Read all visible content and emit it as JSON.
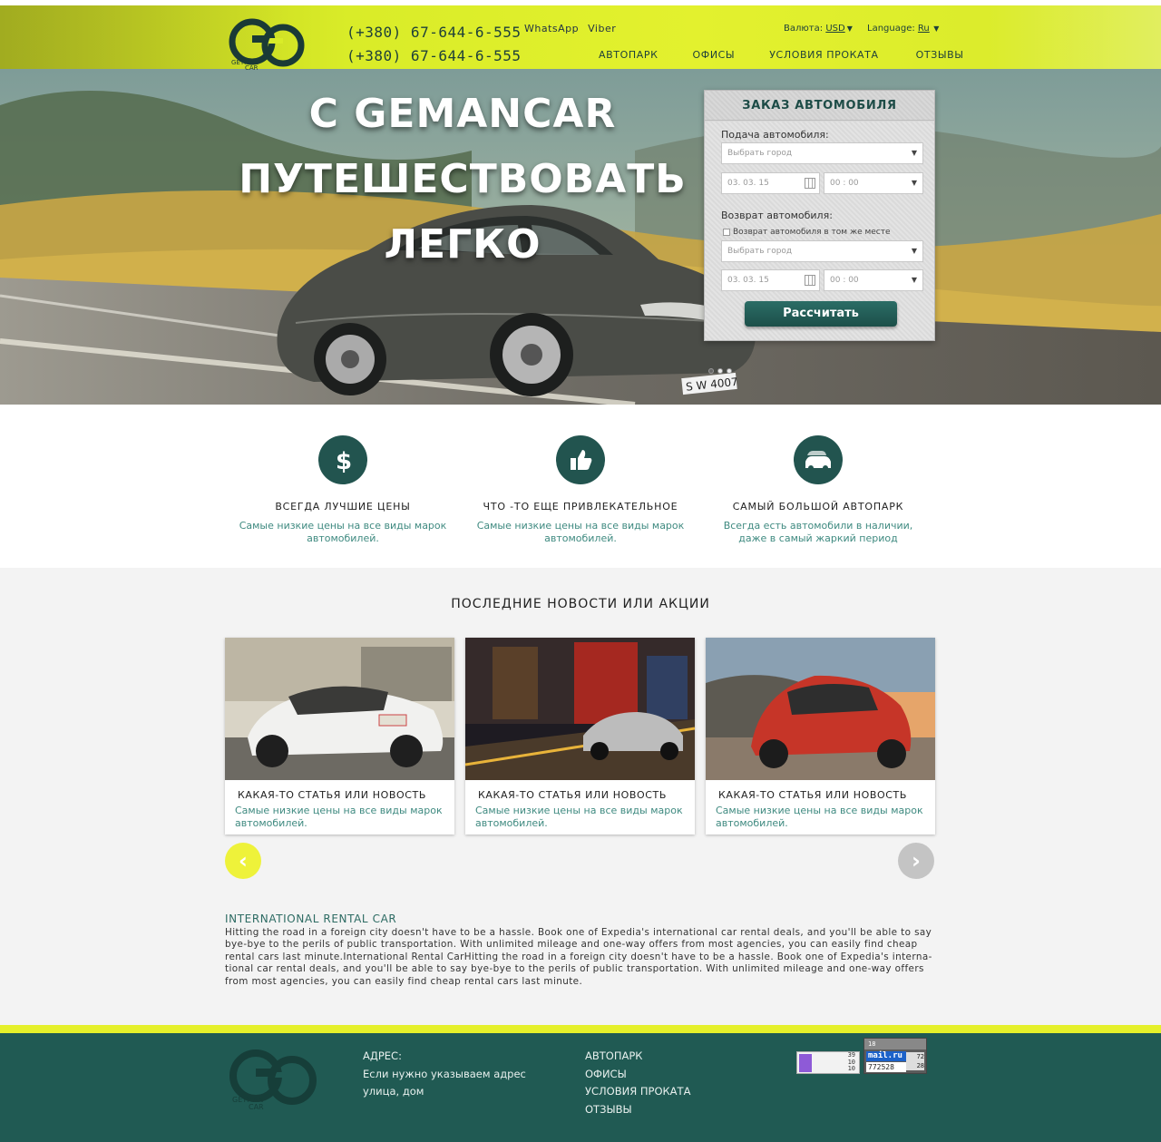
{
  "header": {
    "phones": [
      "(+380) 67-644-6-555",
      "(+380) 67-644-6-555"
    ],
    "messengers": [
      "WhatsApp",
      "Viber"
    ],
    "currency_label": "Валюта:",
    "currency_value": "USD",
    "language_label": "Language:",
    "language_value": "Ru",
    "nav": [
      "АВТОПАРК",
      "ОФИСЫ",
      "УСЛОВИЯ ПРОКАТА",
      "ОТЗЫВЫ"
    ]
  },
  "hero": {
    "title_lines": [
      "С GEMANCAR",
      "ПУТЕШЕСТВОВАТЬ",
      "ЛЕГКО"
    ],
    "license_plate": "S W 4007"
  },
  "order_form": {
    "title": "ЗАКАЗ АВТОМОБИЛЯ",
    "pickup_label": "Подача автомобиля:",
    "pickup_city_placeholder": "Выбрать город",
    "pickup_date": "03. 03. 15",
    "pickup_time": "00 : 00",
    "return_label": "Возврат автомобиля:",
    "same_place_label": "Возврат автомобиля в том же месте",
    "return_city_placeholder": "Выбрать город",
    "return_date": "03. 03. 15",
    "return_time": "00 : 00",
    "submit_label": "Рассчитать"
  },
  "features": [
    {
      "icon": "dollar-icon",
      "title": "ВСЕГДА ЛУЧШИЕ ЦЕНЫ",
      "text": "Самые низкие цены на все виды  марок автомобилей."
    },
    {
      "icon": "thumbs-up-icon",
      "title": "ЧТО -ТО ЕЩЕ ПРИВЛЕКАТЕЛЬНОЕ",
      "text": "Самые низкие цены на все виды  марок автомобилей."
    },
    {
      "icon": "cars-icon",
      "title": "САМЫЙ БОЛЬШОЙ АВТОПАРК",
      "text": "Всегда есть автомобили в наличии, даже в самый жаркий период"
    }
  ],
  "news": {
    "title": "ПОСЛЕДНИЕ НОВОСТИ ИЛИ АКЦИИ",
    "items": [
      {
        "title": "КАКАЯ-ТО СТАТЬЯ ИЛИ НОВОСТЬ",
        "text": "Самые низкие цены на все виды  марок автомобилей.",
        "image": "white-sports-car-photo"
      },
      {
        "title": "КАКАЯ-ТО СТАТЬЯ ИЛИ НОВОСТЬ",
        "text": "Самые низкие цены на все виды  марок автомобилей.",
        "image": "city-night-car-photo"
      },
      {
        "title": "КАКАЯ-ТО СТАТЬЯ ИЛИ НОВОСТЬ",
        "text": "Самые низкие цены на все виды  марок автомобилей.",
        "image": "red-hatchback-photo"
      }
    ]
  },
  "seo": {
    "title": "INTERNATIONAL RENTAL CAR",
    "text": "Hitting the road in a foreign city doesn't have to be a hassle. Book one of Expedia's international car rental deals, and you'll be able to say bye-bye to the perils of public transportation. With unlimited mileage and one-way offers from most agencies, you can easily find cheap rental cars last minute.International Rental CarHitting the road in a foreign city doesn't have to be a hassle. Book one of Expedia's interna-tional car rental deals, and you'll be able to say bye-bye to the perils of public transportation. With unlimited mileage and one-way offers from most agencies, you can easily find cheap rental cars last minute."
  },
  "footer": {
    "address_label": "АДРЕС:",
    "address_lines": [
      "Если нужно указываем адрес",
      "улица, дом"
    ],
    "nav": [
      "АВТОПАРК",
      "ОФИСЫ",
      "УСЛОВИЯ ПРОКАТА",
      "ОТЗЫВЫ"
    ],
    "counter_liveinternet": [
      "39",
      "10",
      "10"
    ],
    "counter_mail_top": "18",
    "counter_mail_brand": "mail.ru",
    "counter_mail_number": "772528",
    "counter_mail_side": [
      "72",
      "28"
    ]
  },
  "logo_text": [
    "GETMAN",
    "CAR"
  ],
  "colors": {
    "accent_yellow": "#e3f12e",
    "dark_teal": "#205a53",
    "teal_text": "#3f8a80"
  }
}
